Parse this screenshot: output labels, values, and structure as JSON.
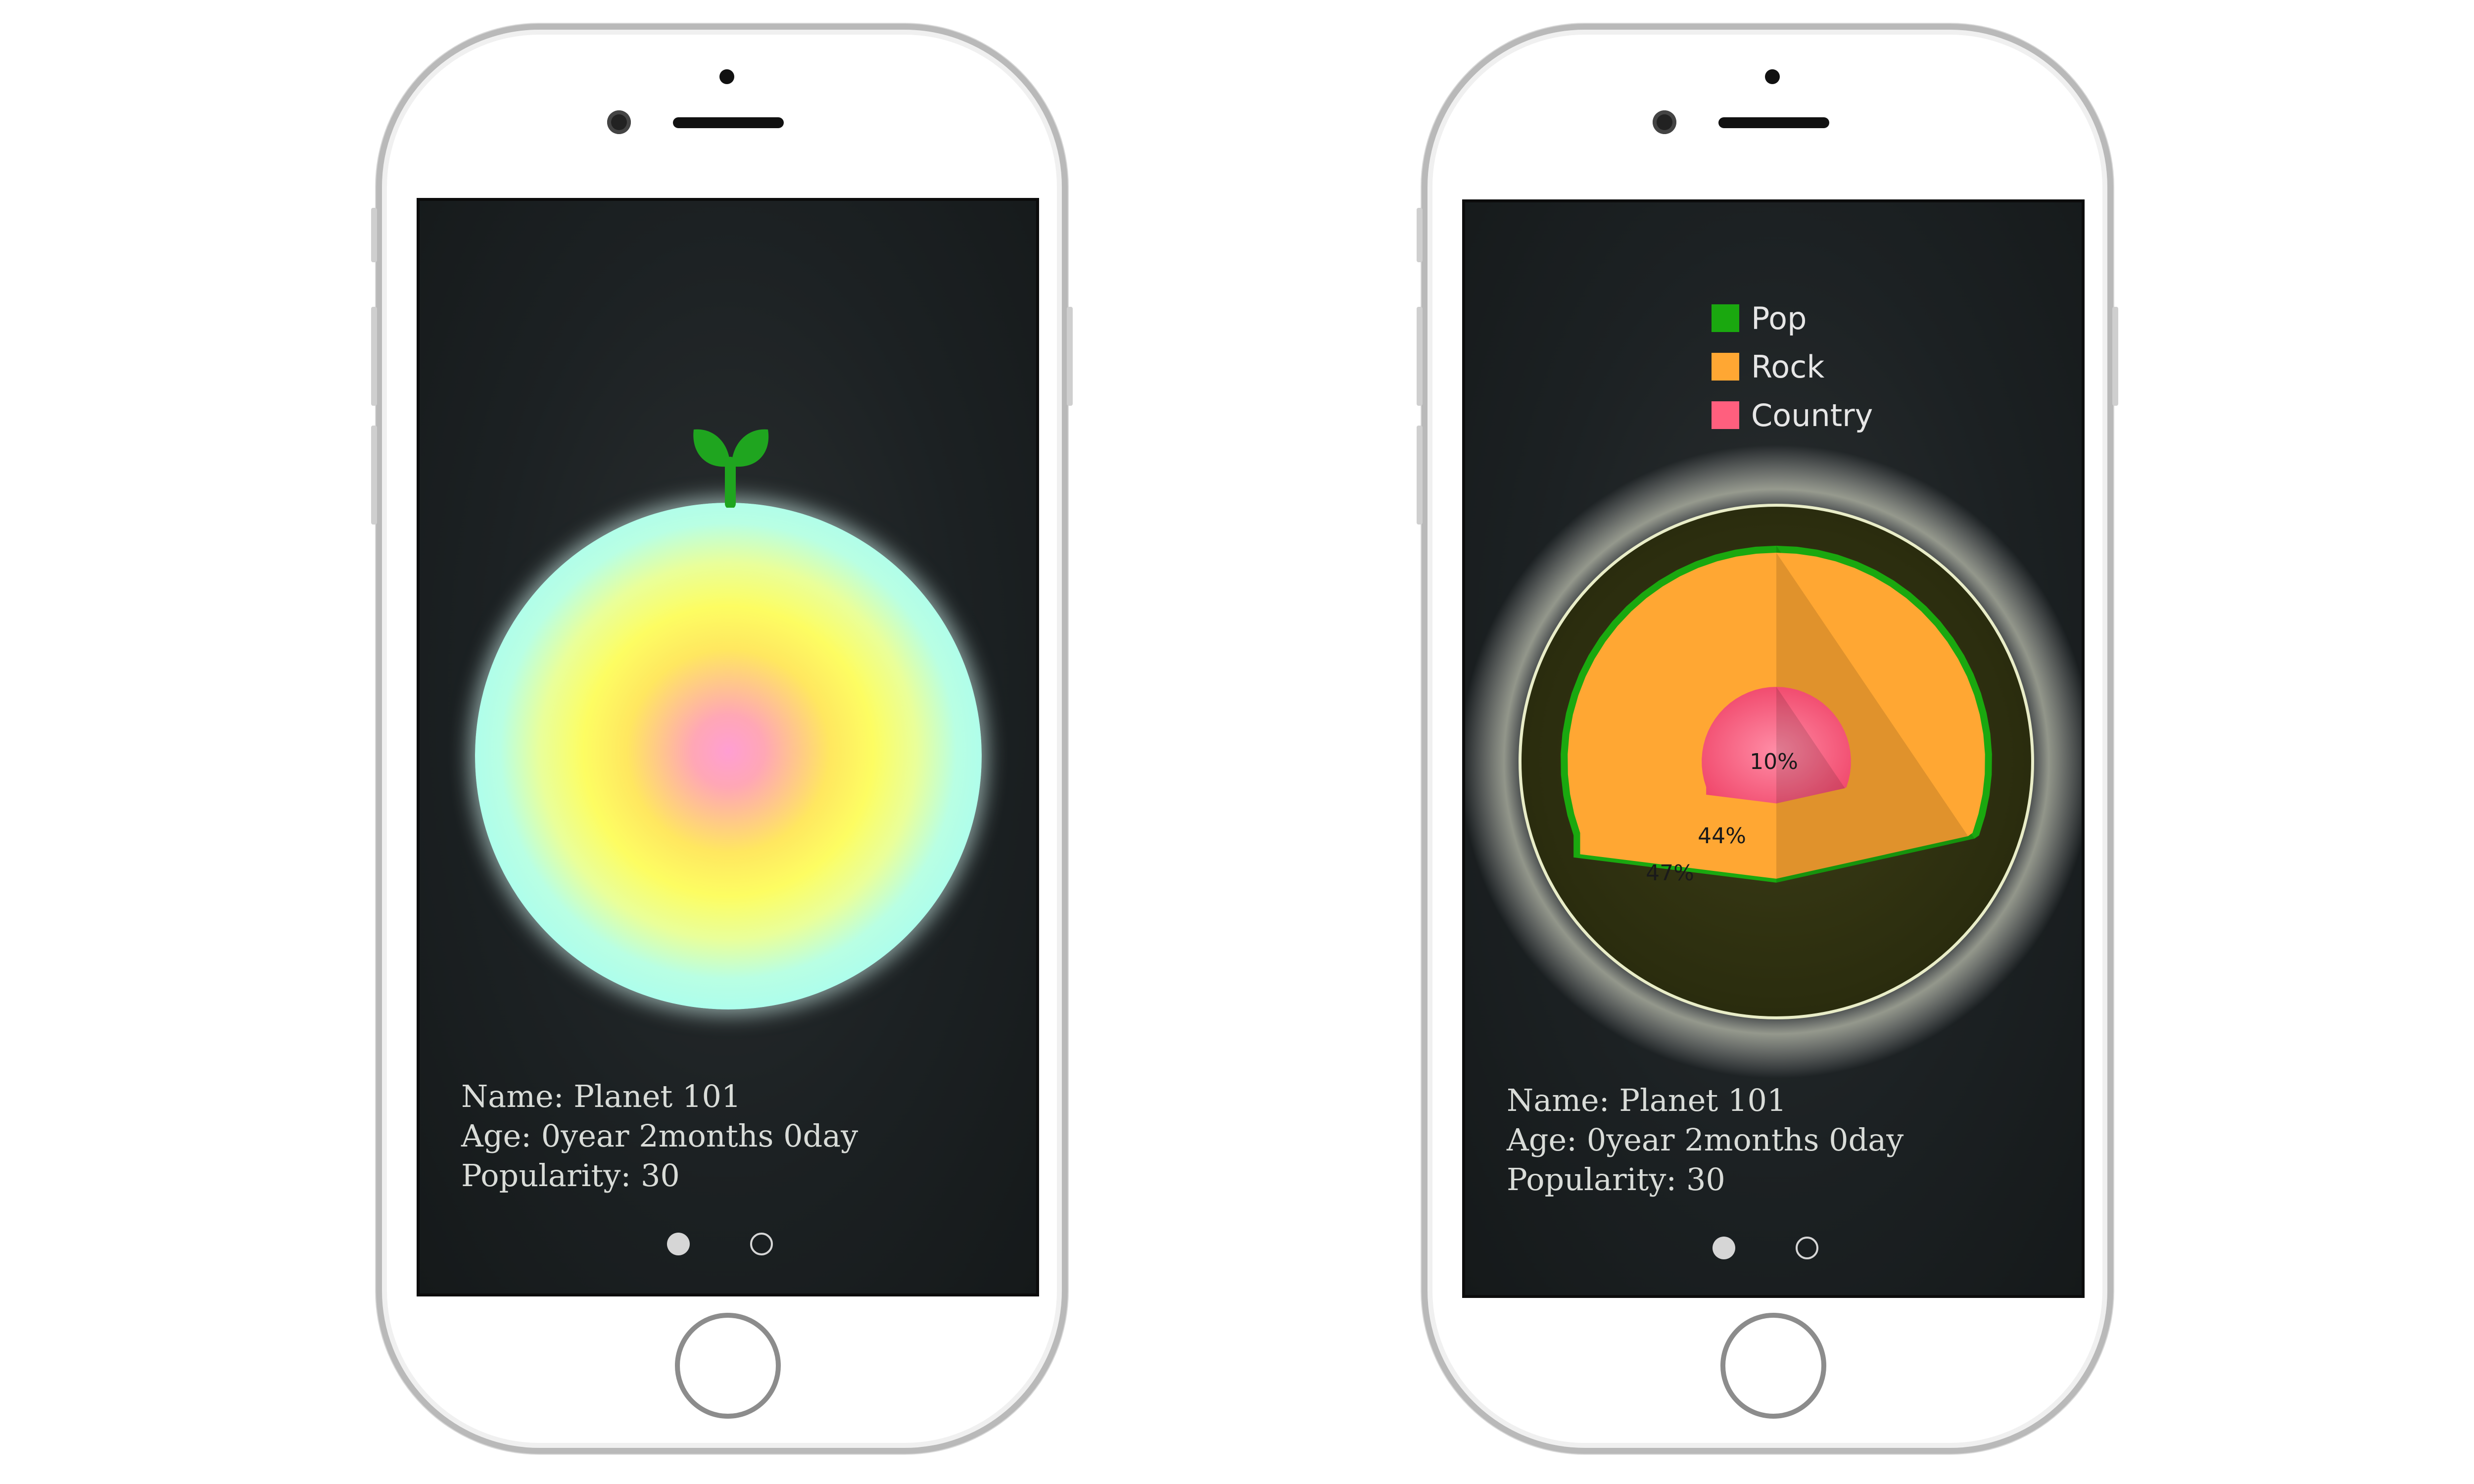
{
  "left_screen": {
    "info": {
      "name": "Name: Planet 101",
      "age": "Age: 0year 2months 0day",
      "popularity": "Popularity: 30"
    },
    "pager": {
      "pages": 2,
      "active_page": 1
    },
    "colors": {
      "planet_center": "#ff9ed2",
      "planet_mid": "#fdfd62",
      "planet_edge": "#a8fdf0",
      "sprout": "#1fa51f"
    }
  },
  "right_screen": {
    "legend": [
      {
        "label": "Pop",
        "color": "#1aa80f"
      },
      {
        "label": "Rock",
        "color": "#ffa733"
      },
      {
        "label": "Country",
        "color": "#ff5f7e"
      }
    ],
    "info": {
      "name": "Name: Planet 101",
      "age": "Age: 0year 2months 0day",
      "popularity": "Popularity: 30"
    },
    "pager": {
      "pages": 2,
      "active_page": 1
    }
  },
  "chart_data": {
    "type": "pie",
    "categories": [
      "Pop",
      "Rock",
      "Country"
    ],
    "values": [
      47,
      44,
      10
    ],
    "labels": [
      "47%",
      "44%",
      "10%"
    ],
    "legend_position": "top-center"
  }
}
